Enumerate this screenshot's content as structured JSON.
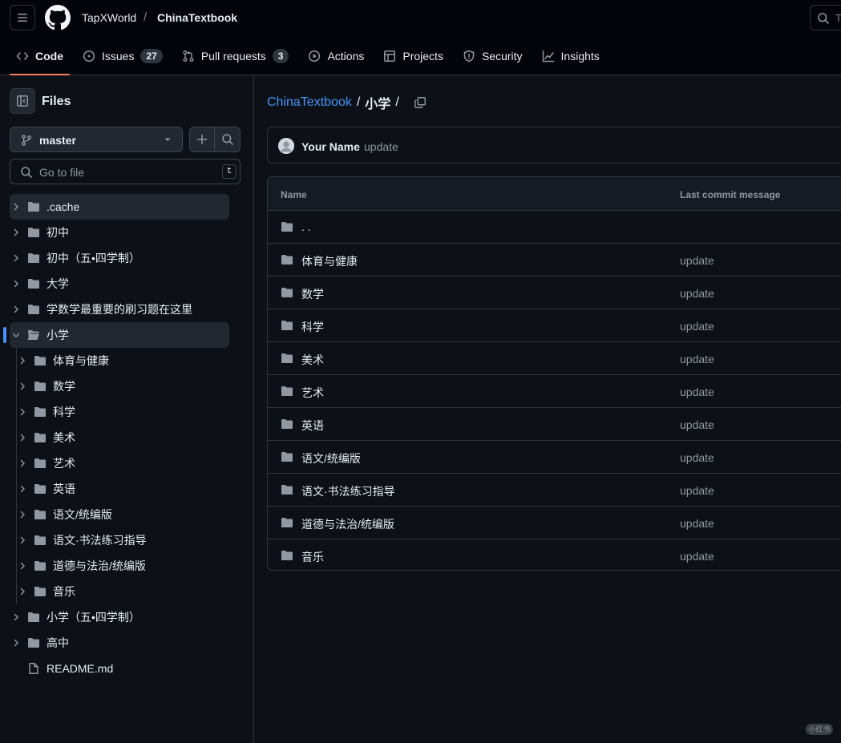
{
  "header": {
    "owner": "TapXWorld",
    "separator": "/",
    "repo": "ChinaTextbook",
    "search_placeholder": "T"
  },
  "nav": {
    "tabs": [
      {
        "label": "Code",
        "icon": "code-icon"
      },
      {
        "label": "Issues",
        "icon": "issue-icon",
        "count": "27"
      },
      {
        "label": "Pull requests",
        "icon": "pull-request-icon",
        "count": "3"
      },
      {
        "label": "Actions",
        "icon": "play-icon"
      },
      {
        "label": "Projects",
        "icon": "table-icon"
      },
      {
        "label": "Security",
        "icon": "shield-icon"
      },
      {
        "label": "Insights",
        "icon": "graph-icon"
      }
    ]
  },
  "sidebar": {
    "title": "Files",
    "branch": "master",
    "goto_placeholder": "Go to file",
    "goto_shortcut": "t",
    "tree": [
      {
        "label": ".cache"
      },
      {
        "label": "初中"
      },
      {
        "label": "初中（五•四学制）"
      },
      {
        "label": "大学"
      },
      {
        "label": "学数学最重要的刷习题在这里"
      },
      {
        "label": "小学"
      },
      {
        "label": "小学（五•四学制）"
      },
      {
        "label": "高中"
      },
      {
        "label": "README.md"
      }
    ],
    "children": [
      {
        "label": "体育与健康"
      },
      {
        "label": "数学"
      },
      {
        "label": "科学"
      },
      {
        "label": "美术"
      },
      {
        "label": "艺术"
      },
      {
        "label": "英语"
      },
      {
        "label": "语文/统编版"
      },
      {
        "label": "语文·书法练习指导"
      },
      {
        "label": "道德与法治/统编版"
      },
      {
        "label": "音乐"
      }
    ]
  },
  "main": {
    "path_repo": "ChinaTextbook",
    "path_sep": "/",
    "path_current": "小学",
    "path_trail": "/",
    "commit": {
      "author": "Your Name",
      "message": "update"
    },
    "table": {
      "col_name": "Name",
      "col_commit": "Last commit message",
      "parent_label": ". .",
      "rows": [
        {
          "name": "体育与健康",
          "commit": "update"
        },
        {
          "name": "数学",
          "commit": "update"
        },
        {
          "name": "科学",
          "commit": "update"
        },
        {
          "name": "美术",
          "commit": "update"
        },
        {
          "name": "艺术",
          "commit": "update"
        },
        {
          "name": "英语",
          "commit": "update"
        },
        {
          "name": "语文/统编版",
          "commit": "update"
        },
        {
          "name": "语文·书法练习指导",
          "commit": "update"
        },
        {
          "name": "道德与法治/统编版",
          "commit": "update"
        },
        {
          "name": "音乐",
          "commit": "update"
        }
      ]
    }
  },
  "watermark": "小红书"
}
